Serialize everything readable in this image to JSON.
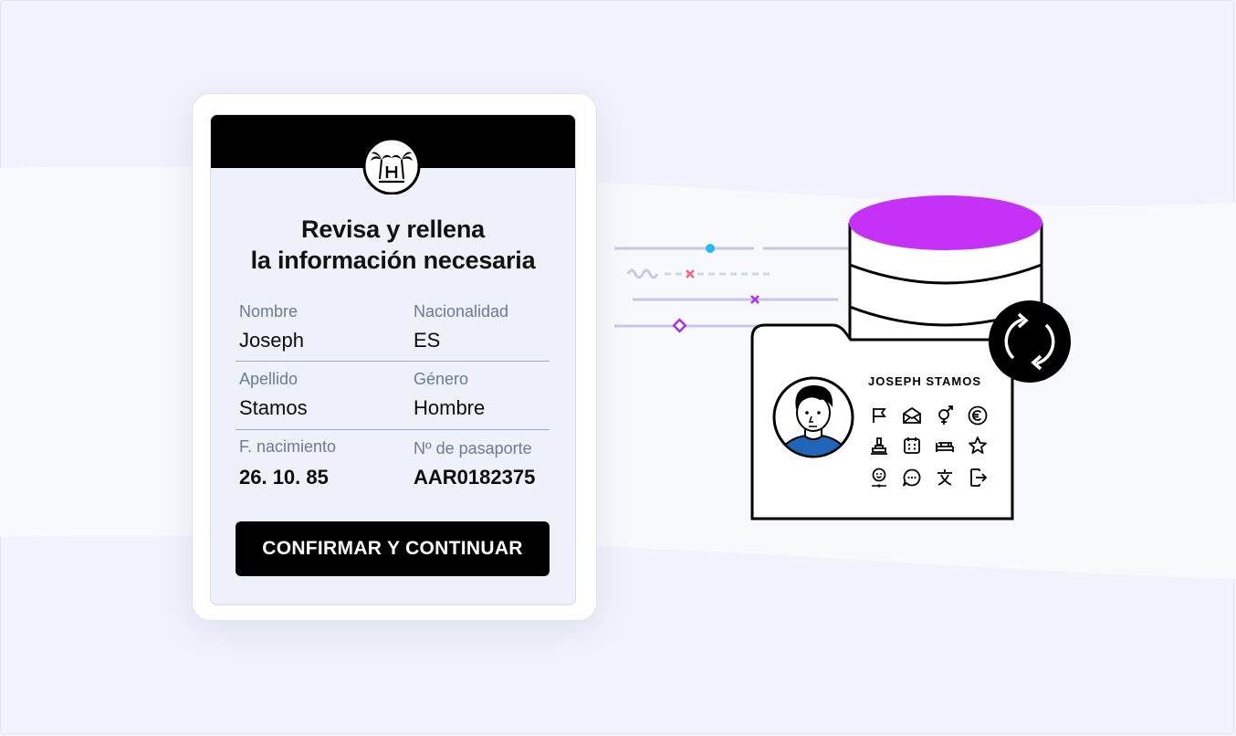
{
  "form": {
    "title_line1": "Revisa y rellena",
    "title_line2": "la información necesaria",
    "fields": [
      {
        "label": "Nombre",
        "value": "Joseph"
      },
      {
        "label": "Nacionalidad",
        "value": "ES"
      },
      {
        "label": "Apellido",
        "value": "Stamos"
      },
      {
        "label": "Género",
        "value": "Hombre"
      },
      {
        "label": "F. nacimiento",
        "value": "26. 10. 85"
      },
      {
        "label": "Nº de pasaporte",
        "value": "AAR0182375"
      }
    ],
    "confirm_label": "CONFIRMAR Y CONTINUAR"
  },
  "profile": {
    "name": "JOSEPH STAMOS",
    "icons": [
      "flag-icon",
      "envelope-icon",
      "gender-icon",
      "euro-icon",
      "stamp-icon",
      "calendar-icon",
      "bed-icon",
      "star-icon",
      "smiley-icon",
      "chat-icon",
      "language-icon",
      "exit-icon"
    ]
  },
  "colors": {
    "database_top": "#c531f7",
    "accent_cyan": "#1ec0f0",
    "accent_pink": "#f06a82",
    "accent_purple": "#b02cf0",
    "shirt_blue": "#1f66b8",
    "label_gray": "#6c7a95"
  }
}
